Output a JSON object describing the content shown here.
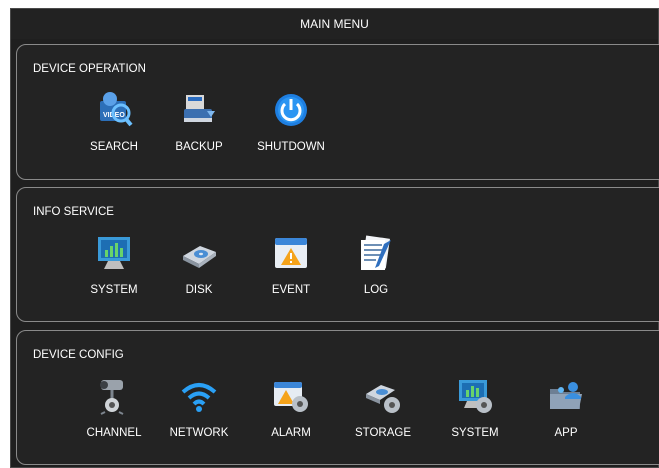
{
  "window": {
    "title": "MAIN MENU"
  },
  "sections": [
    {
      "title": "DEVICE OPERATION",
      "items": [
        {
          "label": "SEARCH",
          "icon": "search-video-icon"
        },
        {
          "label": "BACKUP",
          "icon": "backup-icon"
        },
        {
          "label": "SHUTDOWN",
          "icon": "power-icon"
        }
      ]
    },
    {
      "title": "INFO SERVICE",
      "items": [
        {
          "label": "SYSTEM",
          "icon": "system-monitor-icon"
        },
        {
          "label": "DISK",
          "icon": "disk-drive-icon"
        },
        {
          "label": "EVENT",
          "icon": "warning-event-icon"
        },
        {
          "label": "LOG",
          "icon": "log-document-icon"
        }
      ]
    },
    {
      "title": "DEVICE CONFIG",
      "items": [
        {
          "label": "CHANNEL",
          "icon": "camera-gear-icon"
        },
        {
          "label": "NETWORK",
          "icon": "wifi-icon"
        },
        {
          "label": "ALARM",
          "icon": "alarm-gear-icon"
        },
        {
          "label": "STORAGE",
          "icon": "storage-gear-icon"
        },
        {
          "label": "SYSTEM",
          "icon": "system-gear-icon"
        },
        {
          "label": "APP",
          "icon": "app-folder-icon"
        }
      ]
    }
  ],
  "colors": {
    "background": "#1f1f1f",
    "panel_border": "#8a8a8a",
    "text": "#ffffff",
    "accent_blue": "#1e90ff"
  }
}
